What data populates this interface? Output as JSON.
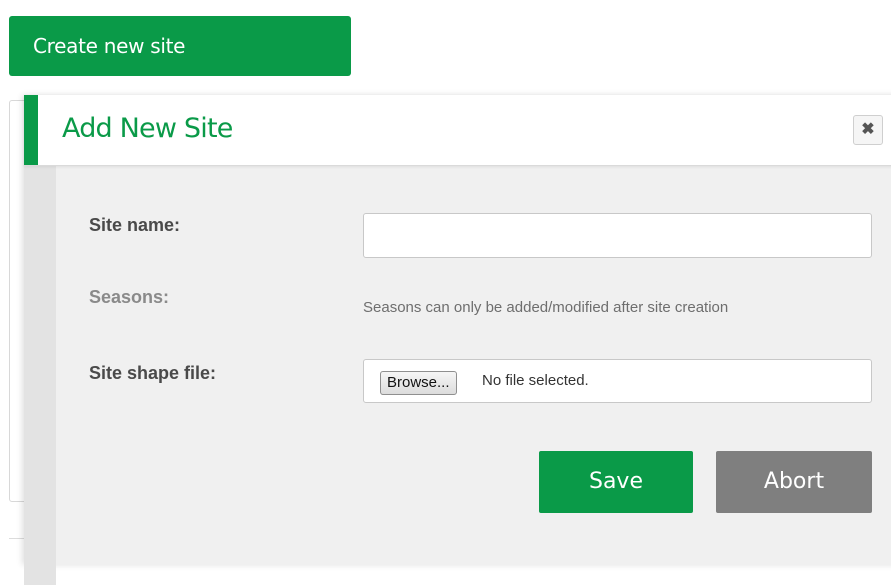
{
  "toolbar": {
    "create_label": "Create new site"
  },
  "dialog": {
    "title": "Add New Site",
    "close_glyph": "✖",
    "fields": {
      "site_name_label": "Site name:",
      "site_name_value": "",
      "seasons_label": "Seasons:",
      "seasons_note": "Seasons can only be added/modified after site creation",
      "shape_file_label": "Site shape file:",
      "browse_label": "Browse...",
      "file_status": "No file selected."
    },
    "save_label": "Save",
    "abort_label": "Abort"
  },
  "colors": {
    "accent": "#0a9a48",
    "abort": "#7f7f7f"
  },
  "icons": {
    "close": "close-icon"
  }
}
